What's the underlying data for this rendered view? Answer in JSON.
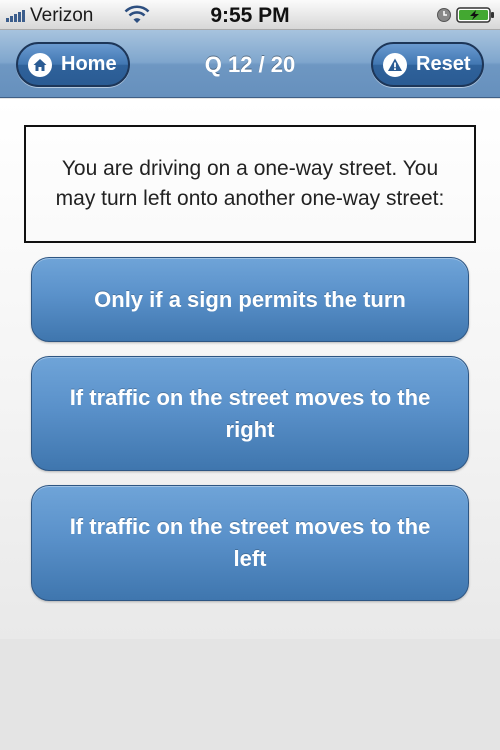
{
  "status_bar": {
    "carrier": "Verizon",
    "time": "9:55 PM",
    "icons": [
      "signal-icon",
      "wifi-icon",
      "alarm-clock-icon",
      "battery-charging-icon"
    ]
  },
  "nav": {
    "home_label": "Home",
    "title": "Q 12 / 20",
    "reset_label": "Reset",
    "icons": [
      "home-icon",
      "warning-icon"
    ]
  },
  "question": {
    "text": "You are driving on a one-way street. You may turn left onto another one-way street:"
  },
  "answers": [
    {
      "label": "Only if a sign permits the turn"
    },
    {
      "label": "If traffic on the street moves to the right"
    },
    {
      "label": "If traffic on the street moves to the left"
    }
  ],
  "colors": {
    "nav_gradient_top": "#a7c3de",
    "nav_gradient_bottom": "#6690bd",
    "answer_button": "#5a91ca",
    "nav_button": "#2f629b"
  }
}
